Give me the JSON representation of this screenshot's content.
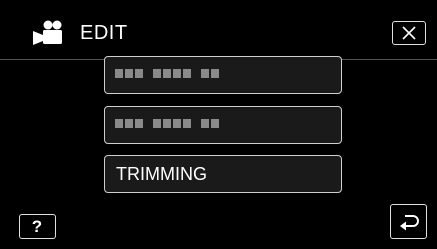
{
  "header": {
    "mode_icon": "movie-camera-icon",
    "title": "EDIT",
    "close_icon": "close-icon"
  },
  "menu": {
    "items": [
      {
        "label": "",
        "state": "redacted-placeholder"
      },
      {
        "label": "",
        "state": "redacted-placeholder"
      },
      {
        "label": "TRIMMING",
        "state": "normal"
      }
    ]
  },
  "footer": {
    "help_label": "?",
    "return_icon": "return-arrow-icon"
  },
  "colors": {
    "background": "#000000",
    "button_border": "#cfcfcf",
    "placeholder_dots": "#8a8a8a",
    "text": "#ffffff"
  }
}
